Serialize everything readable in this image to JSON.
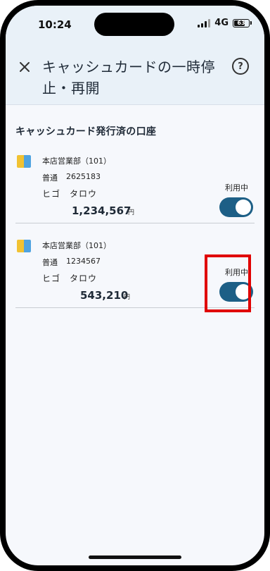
{
  "status_bar": {
    "time": "10:24",
    "network": "4G",
    "battery": "63"
  },
  "header": {
    "title": "キャッシュカードの一時停止・再開",
    "close_icon": "close-icon",
    "help_icon": "help-icon"
  },
  "section": {
    "title": "キャッシュカード発行済の口座"
  },
  "accounts": [
    {
      "branch": "本店営業部（101）",
      "type": "普通",
      "number": "2625183",
      "holder": "ヒゴ　タロウ",
      "balance": "1,234,567",
      "currency": "円",
      "status": "利用中",
      "enabled": true
    },
    {
      "branch": "本店営業部（101）",
      "type": "普通",
      "number": "1234567",
      "holder": "ヒゴ　タロウ",
      "balance": "543,210",
      "currency": "円",
      "status": "利用中",
      "enabled": true
    }
  ],
  "colors": {
    "toggle_on": "#1d5f86",
    "highlight": "#e00000",
    "header_bg": "#e9f1f8"
  }
}
